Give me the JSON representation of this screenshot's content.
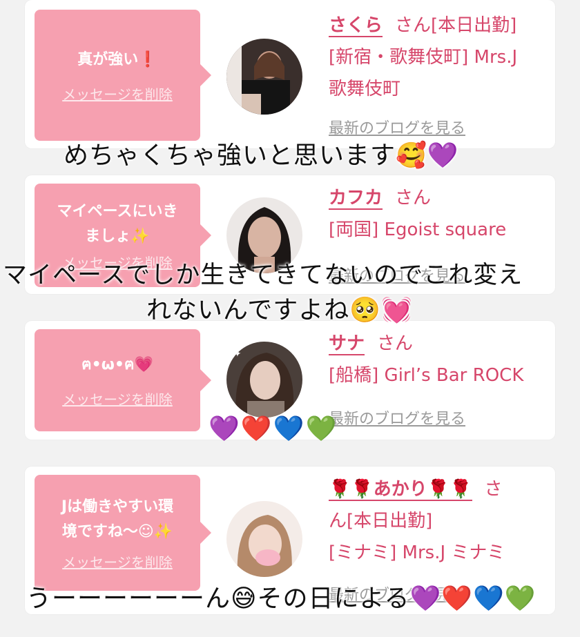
{
  "cards": [
    {
      "bubble_message": "真が強い❗",
      "delete_label": "メッセージを削除",
      "name": "さくら",
      "honorific": "さん",
      "status": "[本日出勤]",
      "store_line1": "[新宿・歌舞伎町] Mrs.J",
      "store_line2": "歌舞伎町",
      "blog_link": "最新のブログを見る"
    },
    {
      "bubble_message_line1": "マイペースにいき",
      "bubble_message_line2": "ましょ✨",
      "delete_label": "メッセージを削除",
      "name": "カフカ",
      "honorific": "さん",
      "store_line1": "[両国] Egoist square",
      "blog_link": "最新のブログを見る"
    },
    {
      "bubble_message": "ฅ•ω•ฅ💗",
      "delete_label": "メッセージを削除",
      "name": "サナ",
      "honorific": "さん",
      "store_line1": "[船橋] Girl’s Bar ROCK",
      "blog_link": "最新のブログを見る"
    },
    {
      "bubble_message_line1": "Jは働きやすい環",
      "bubble_message_line2": "境ですね〜☺✨",
      "delete_label": "メッセージを削除",
      "name": "🌹🌹あかり🌹🌹",
      "honorific": "さ",
      "status_line": "ん[本日出勤]",
      "store_line1": "[ミナミ] Mrs.J ミナミ",
      "blog_link": "最新のブログを見る"
    }
  ],
  "overlays": {
    "caption1": "めちゃくちゃ強いと思います🥰💜",
    "caption2_line1": "マイペースでしか生きてきてないのでこれ変え",
    "caption2_line2": "れないんですよね🥺💓",
    "caption3": "💜❤️💙💚",
    "caption4": "うーーーーーーん😅その日による💜❤️💙💚"
  },
  "colors": {
    "accent": "#d6466a",
    "bubble": "#f6a0b0",
    "link_gray": "#9a9a9a"
  }
}
